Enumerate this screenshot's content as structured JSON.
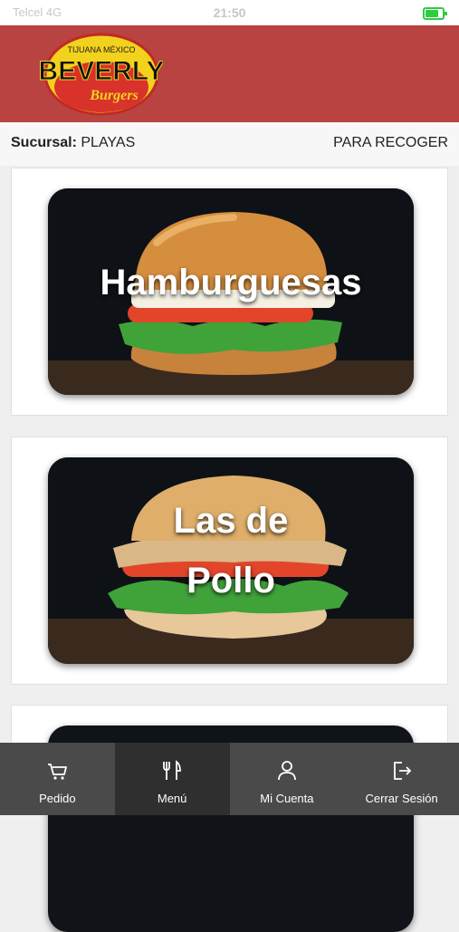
{
  "status": {
    "left": "Telcel 4G",
    "time": "21:50",
    "battery_level": 0.85
  },
  "header": {
    "logo_top": "TIJUANA MÉXICO",
    "logo_main": "BEVERLY",
    "logo_sub": "Burgers"
  },
  "branch": {
    "label": "Sucursal:",
    "value": "PLAYAS",
    "mode": "PARA RECOGER"
  },
  "categories": [
    {
      "label": "Hamburguesas"
    },
    {
      "line1": "Las de",
      "line2": "Pollo"
    }
  ],
  "tabs": [
    {
      "label": "Pedido",
      "icon": "cart-icon"
    },
    {
      "label": "Menú",
      "icon": "utensils-icon"
    },
    {
      "label": "Mi Cuenta",
      "icon": "user-icon"
    },
    {
      "label": "Cerrar Sesión",
      "icon": "logout-icon"
    }
  ],
  "colors": {
    "header": "#b94340",
    "tabbar": "#4a4a4a",
    "tab_active": "#2f2f2f"
  }
}
